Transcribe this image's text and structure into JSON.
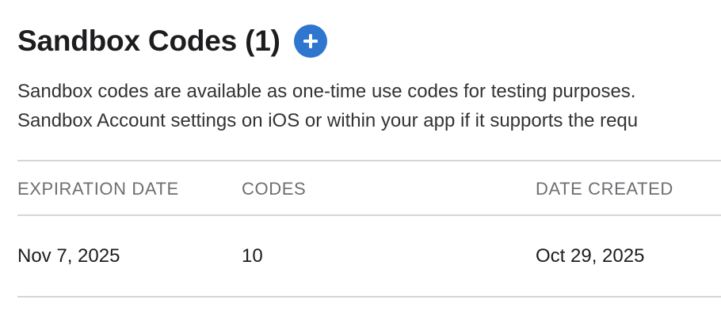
{
  "header": {
    "title": "Sandbox Codes (1)",
    "add_icon": "plus-circle-icon",
    "accent_color": "#2f76cf"
  },
  "description": {
    "line1": "Sandbox codes are available as one-time use codes for testing purposes.",
    "line2": "Sandbox Account settings on iOS or within your app if it supports the requ"
  },
  "table": {
    "columns": [
      "EXPIRATION DATE",
      "CODES",
      "DATE CREATED"
    ],
    "rows": [
      [
        "Nov 7, 2025",
        "10",
        "Oct 29, 2025"
      ]
    ]
  }
}
